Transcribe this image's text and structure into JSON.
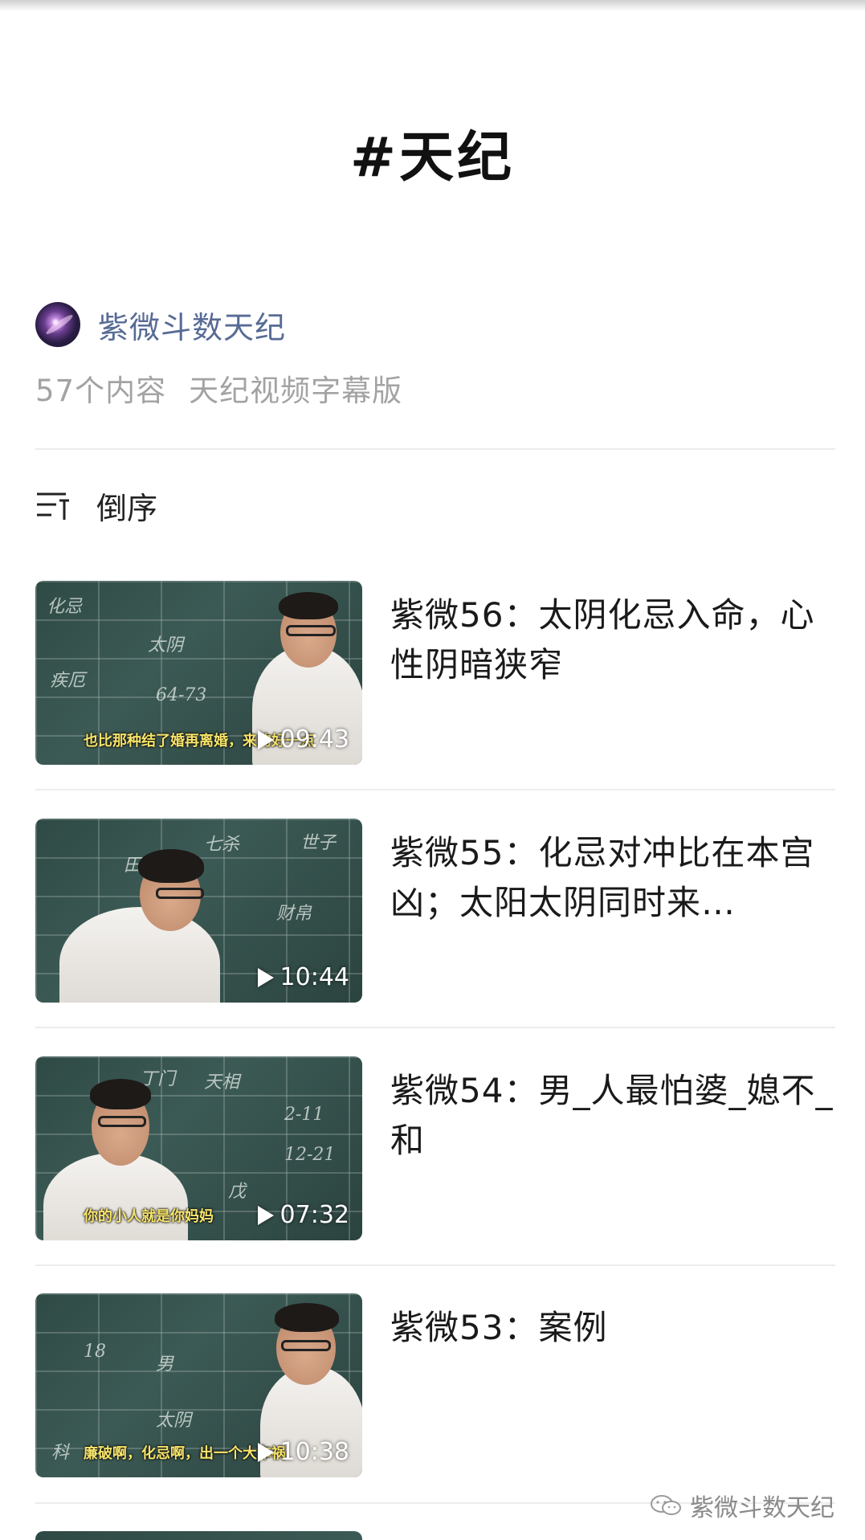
{
  "page": {
    "title": "#天纪"
  },
  "account": {
    "name": "紫微斗数天纪"
  },
  "collection": {
    "count": "57个内容",
    "name": "天纪视频字幕版"
  },
  "sort": {
    "label": "倒序",
    "icon": "sort-order-icon"
  },
  "videos": [
    {
      "title": "紫微56：太阴化忌入命，心性阴暗狭窄",
      "duration": "09:43",
      "subtitle": "也比那种结了婚再离婚，来的好一点"
    },
    {
      "title": "紫微55：化忌对冲比在本宫凶；太阳太阴同时来…",
      "duration": "10:44",
      "subtitle": ""
    },
    {
      "title": "紫微54：男_人最怕婆_媳不_和",
      "duration": "07:32",
      "subtitle": "你的小人就是你妈妈"
    },
    {
      "title": "紫微53：案例",
      "duration": "10:38",
      "subtitle": "廉破啊，化忌啊，出一个大车祸"
    }
  ],
  "watermark": {
    "text": "紫微斗数天纪",
    "icon": "wechat-icon"
  },
  "colors": {
    "account_blue": "#576b95",
    "meta_gray": "#a3a3a3",
    "divider": "#ececec"
  }
}
